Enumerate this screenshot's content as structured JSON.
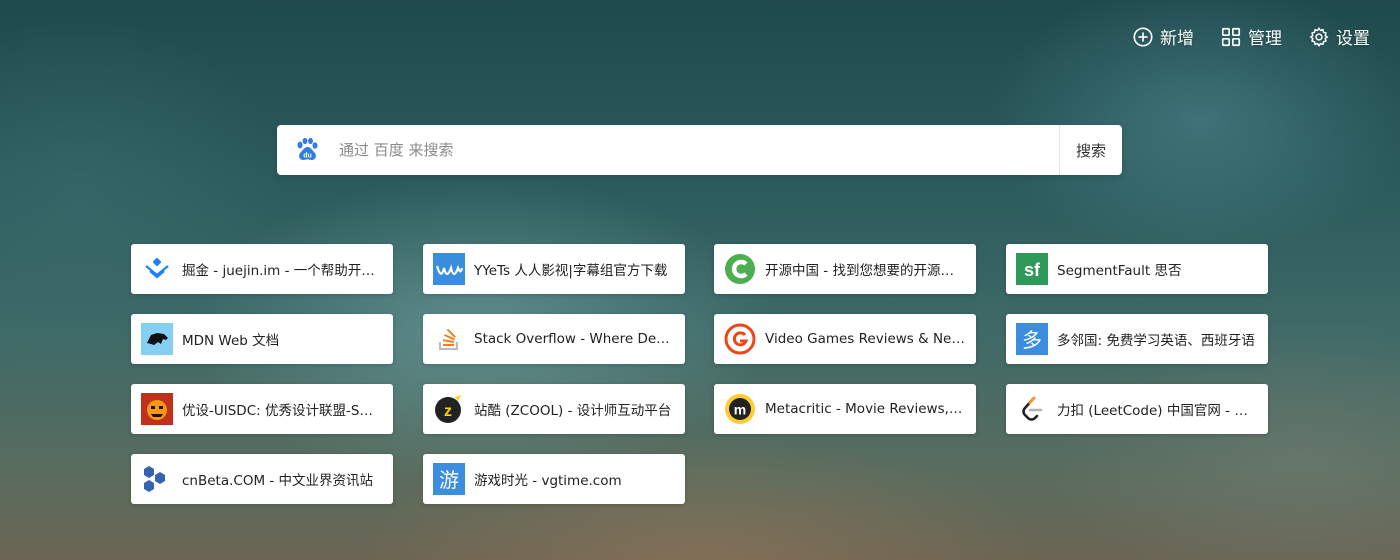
{
  "toolbar": {
    "add_label": "新增",
    "manage_label": "管理",
    "settings_label": "设置"
  },
  "search": {
    "placeholder": "通过 百度 来搜索",
    "button_label": "搜索",
    "engine_icon": "baidu-paw-icon"
  },
  "tiles": [
    {
      "label": "掘金 - juejin.im - 一个帮助开发者成长的社区",
      "icon": "juejin-icon"
    },
    {
      "label": "YYeTs 人人影视|字幕组官方下载",
      "icon": "yyets-icon"
    },
    {
      "label": "开源中国 - 找到您想要的开源项目",
      "icon": "oschina-icon"
    },
    {
      "label": "SegmentFault 思否",
      "icon": "segmentfault-icon"
    },
    {
      "label": "MDN Web 文档",
      "icon": "mdn-icon"
    },
    {
      "label": "Stack Overflow - Where Developers Learn",
      "icon": "stackoverflow-icon"
    },
    {
      "label": "Video Games Reviews & News - GameSpot",
      "icon": "gamespot-icon"
    },
    {
      "label": "多邻国: 免费学习英语、西班牙语",
      "icon": "duolingo-icon"
    },
    {
      "label": "优设-UISDC: 优秀设计联盟-SDC设计",
      "icon": "uisdc-icon"
    },
    {
      "label": "站酷 (ZCOOL) - 设计师互动平台",
      "icon": "zcool-icon"
    },
    {
      "label": "Metacritic - Movie Reviews, TV Reviews",
      "icon": "metacritic-icon"
    },
    {
      "label": "力扣 (LeetCode) 中国官网 - 全球极客",
      "icon": "leetcode-icon"
    },
    {
      "label": "cnBeta.COM - 中文业界资讯站",
      "icon": "cnbeta-icon"
    },
    {
      "label": "游戏时光 - vgtime.com",
      "icon": "vgtime-icon"
    }
  ]
}
